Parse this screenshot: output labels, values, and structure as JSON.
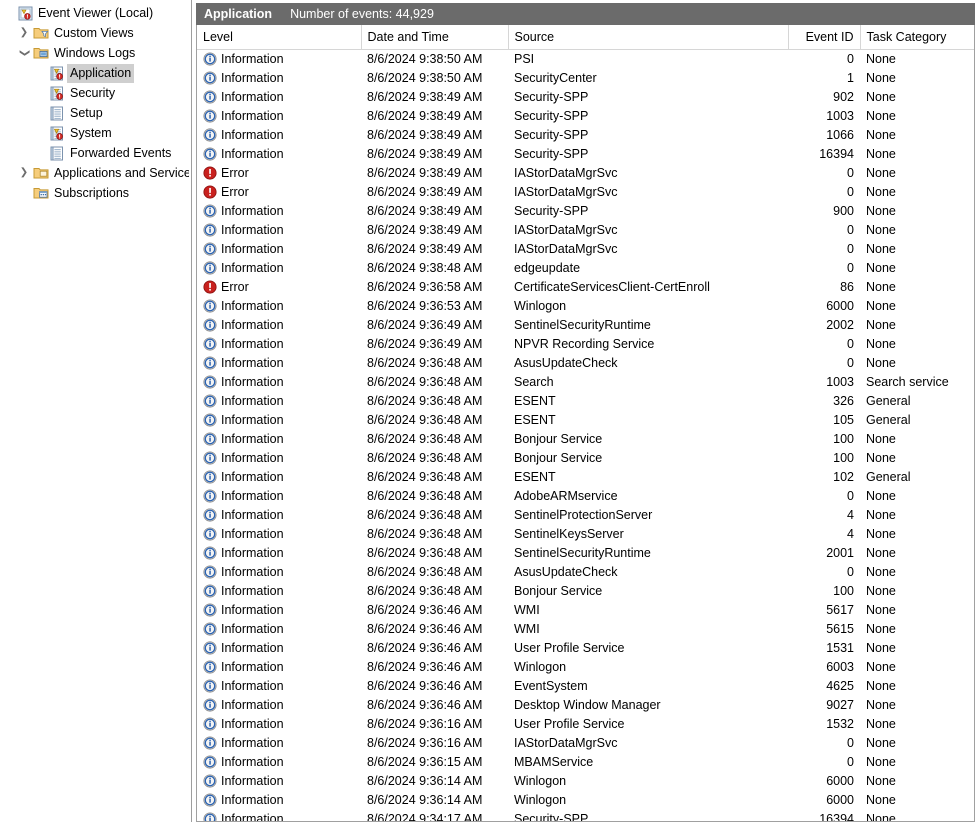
{
  "sidebar": {
    "items": [
      {
        "label": "Event Viewer (Local)",
        "icon": "event-viewer-icon",
        "indent": 0,
        "twisty": "",
        "selected": false
      },
      {
        "label": "Custom Views",
        "icon": "custom-views-folder-icon",
        "indent": 1,
        "twisty": "collapsed",
        "selected": false
      },
      {
        "label": "Windows Logs",
        "icon": "windows-logs-folder-icon",
        "indent": 1,
        "twisty": "expanded",
        "selected": false
      },
      {
        "label": "Application",
        "icon": "log-alert-icon",
        "indent": 2,
        "twisty": "",
        "selected": true
      },
      {
        "label": "Security",
        "icon": "log-alert-icon",
        "indent": 2,
        "twisty": "",
        "selected": false
      },
      {
        "label": "Setup",
        "icon": "log-plain-icon",
        "indent": 2,
        "twisty": "",
        "selected": false
      },
      {
        "label": "System",
        "icon": "log-alert-icon",
        "indent": 2,
        "twisty": "",
        "selected": false
      },
      {
        "label": "Forwarded Events",
        "icon": "log-plain-icon",
        "indent": 2,
        "twisty": "",
        "selected": false
      },
      {
        "label": "Applications and Services Lo",
        "icon": "apps-services-folder-icon",
        "indent": 1,
        "twisty": "collapsed",
        "selected": false
      },
      {
        "label": "Subscriptions",
        "icon": "subscriptions-folder-icon",
        "indent": 1,
        "twisty": "",
        "selected": false
      }
    ]
  },
  "pane": {
    "title": "Application",
    "event_count_label": "Number of events: 44,929"
  },
  "table": {
    "columns": [
      "Level",
      "Date and Time",
      "Source",
      "Event ID",
      "Task Category"
    ],
    "rows": [
      {
        "level": "Information",
        "icon": "information-icon",
        "date": "8/6/2024 9:38:50 AM",
        "source": "PSI",
        "event_id": "0",
        "task": "None"
      },
      {
        "level": "Information",
        "icon": "information-icon",
        "date": "8/6/2024 9:38:50 AM",
        "source": "SecurityCenter",
        "event_id": "1",
        "task": "None"
      },
      {
        "level": "Information",
        "icon": "information-icon",
        "date": "8/6/2024 9:38:49 AM",
        "source": "Security-SPP",
        "event_id": "902",
        "task": "None"
      },
      {
        "level": "Information",
        "icon": "information-icon",
        "date": "8/6/2024 9:38:49 AM",
        "source": "Security-SPP",
        "event_id": "1003",
        "task": "None"
      },
      {
        "level": "Information",
        "icon": "information-icon",
        "date": "8/6/2024 9:38:49 AM",
        "source": "Security-SPP",
        "event_id": "1066",
        "task": "None"
      },
      {
        "level": "Information",
        "icon": "information-icon",
        "date": "8/6/2024 9:38:49 AM",
        "source": "Security-SPP",
        "event_id": "16394",
        "task": "None"
      },
      {
        "level": "Error",
        "icon": "error-icon",
        "date": "8/6/2024 9:38:49 AM",
        "source": "IAStorDataMgrSvc",
        "event_id": "0",
        "task": "None"
      },
      {
        "level": "Error",
        "icon": "error-icon",
        "date": "8/6/2024 9:38:49 AM",
        "source": "IAStorDataMgrSvc",
        "event_id": "0",
        "task": "None"
      },
      {
        "level": "Information",
        "icon": "information-icon",
        "date": "8/6/2024 9:38:49 AM",
        "source": "Security-SPP",
        "event_id": "900",
        "task": "None"
      },
      {
        "level": "Information",
        "icon": "information-icon",
        "date": "8/6/2024 9:38:49 AM",
        "source": "IAStorDataMgrSvc",
        "event_id": "0",
        "task": "None"
      },
      {
        "level": "Information",
        "icon": "information-icon",
        "date": "8/6/2024 9:38:49 AM",
        "source": "IAStorDataMgrSvc",
        "event_id": "0",
        "task": "None"
      },
      {
        "level": "Information",
        "icon": "information-icon",
        "date": "8/6/2024 9:38:48 AM",
        "source": "edgeupdate",
        "event_id": "0",
        "task": "None"
      },
      {
        "level": "Error",
        "icon": "error-icon",
        "date": "8/6/2024 9:36:58 AM",
        "source": "CertificateServicesClient-CertEnroll",
        "event_id": "86",
        "task": "None"
      },
      {
        "level": "Information",
        "icon": "information-icon",
        "date": "8/6/2024 9:36:53 AM",
        "source": "Winlogon",
        "event_id": "6000",
        "task": "None"
      },
      {
        "level": "Information",
        "icon": "information-icon",
        "date": "8/6/2024 9:36:49 AM",
        "source": "SentinelSecurityRuntime",
        "event_id": "2002",
        "task": "None"
      },
      {
        "level": "Information",
        "icon": "information-icon",
        "date": "8/6/2024 9:36:49 AM",
        "source": "NPVR Recording Service",
        "event_id": "0",
        "task": "None"
      },
      {
        "level": "Information",
        "icon": "information-icon",
        "date": "8/6/2024 9:36:48 AM",
        "source": "AsusUpdateCheck",
        "event_id": "0",
        "task": "None"
      },
      {
        "level": "Information",
        "icon": "information-icon",
        "date": "8/6/2024 9:36:48 AM",
        "source": "Search",
        "event_id": "1003",
        "task": "Search service"
      },
      {
        "level": "Information",
        "icon": "information-icon",
        "date": "8/6/2024 9:36:48 AM",
        "source": "ESENT",
        "event_id": "326",
        "task": "General"
      },
      {
        "level": "Information",
        "icon": "information-icon",
        "date": "8/6/2024 9:36:48 AM",
        "source": "ESENT",
        "event_id": "105",
        "task": "General"
      },
      {
        "level": "Information",
        "icon": "information-icon",
        "date": "8/6/2024 9:36:48 AM",
        "source": "Bonjour Service",
        "event_id": "100",
        "task": "None"
      },
      {
        "level": "Information",
        "icon": "information-icon",
        "date": "8/6/2024 9:36:48 AM",
        "source": "Bonjour Service",
        "event_id": "100",
        "task": "None"
      },
      {
        "level": "Information",
        "icon": "information-icon",
        "date": "8/6/2024 9:36:48 AM",
        "source": "ESENT",
        "event_id": "102",
        "task": "General"
      },
      {
        "level": "Information",
        "icon": "information-icon",
        "date": "8/6/2024 9:36:48 AM",
        "source": "AdobeARMservice",
        "event_id": "0",
        "task": "None"
      },
      {
        "level": "Information",
        "icon": "information-icon",
        "date": "8/6/2024 9:36:48 AM",
        "source": "SentinelProtectionServer",
        "event_id": "4",
        "task": "None"
      },
      {
        "level": "Information",
        "icon": "information-icon",
        "date": "8/6/2024 9:36:48 AM",
        "source": "SentinelKeysServer",
        "event_id": "4",
        "task": "None"
      },
      {
        "level": "Information",
        "icon": "information-icon",
        "date": "8/6/2024 9:36:48 AM",
        "source": "SentinelSecurityRuntime",
        "event_id": "2001",
        "task": "None"
      },
      {
        "level": "Information",
        "icon": "information-icon",
        "date": "8/6/2024 9:36:48 AM",
        "source": "AsusUpdateCheck",
        "event_id": "0",
        "task": "None"
      },
      {
        "level": "Information",
        "icon": "information-icon",
        "date": "8/6/2024 9:36:48 AM",
        "source": "Bonjour Service",
        "event_id": "100",
        "task": "None"
      },
      {
        "level": "Information",
        "icon": "information-icon",
        "date": "8/6/2024 9:36:46 AM",
        "source": "WMI",
        "event_id": "5617",
        "task": "None"
      },
      {
        "level": "Information",
        "icon": "information-icon",
        "date": "8/6/2024 9:36:46 AM",
        "source": "WMI",
        "event_id": "5615",
        "task": "None"
      },
      {
        "level": "Information",
        "icon": "information-icon",
        "date": "8/6/2024 9:36:46 AM",
        "source": "User Profile Service",
        "event_id": "1531",
        "task": "None"
      },
      {
        "level": "Information",
        "icon": "information-icon",
        "date": "8/6/2024 9:36:46 AM",
        "source": "Winlogon",
        "event_id": "6003",
        "task": "None"
      },
      {
        "level": "Information",
        "icon": "information-icon",
        "date": "8/6/2024 9:36:46 AM",
        "source": "EventSystem",
        "event_id": "4625",
        "task": "None"
      },
      {
        "level": "Information",
        "icon": "information-icon",
        "date": "8/6/2024 9:36:46 AM",
        "source": "Desktop Window Manager",
        "event_id": "9027",
        "task": "None"
      },
      {
        "level": "Information",
        "icon": "information-icon",
        "date": "8/6/2024 9:36:16 AM",
        "source": "User Profile Service",
        "event_id": "1532",
        "task": "None"
      },
      {
        "level": "Information",
        "icon": "information-icon",
        "date": "8/6/2024 9:36:16 AM",
        "source": "IAStorDataMgrSvc",
        "event_id": "0",
        "task": "None"
      },
      {
        "level": "Information",
        "icon": "information-icon",
        "date": "8/6/2024 9:36:15 AM",
        "source": "MBAMService",
        "event_id": "0",
        "task": "None"
      },
      {
        "level": "Information",
        "icon": "information-icon",
        "date": "8/6/2024 9:36:14 AM",
        "source": "Winlogon",
        "event_id": "6000",
        "task": "None"
      },
      {
        "level": "Information",
        "icon": "information-icon",
        "date": "8/6/2024 9:36:14 AM",
        "source": "Winlogon",
        "event_id": "6000",
        "task": "None"
      },
      {
        "level": "Information",
        "icon": "information-icon",
        "date": "8/6/2024 9:34:17 AM",
        "source": "Security-SPP",
        "event_id": "16394",
        "task": "None"
      }
    ]
  },
  "colors": {
    "header_bar": "#6b6b6b",
    "selection": "#cfcfcf",
    "info_icon": "#2a62b0",
    "error_icon": "#c9211e",
    "folder": "#f5c96a",
    "grid_line": "#d6d6d6"
  }
}
